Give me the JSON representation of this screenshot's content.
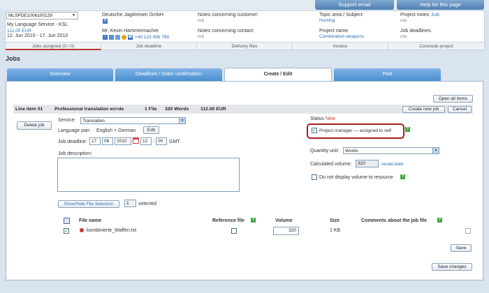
{
  "top": {
    "support": "Support email",
    "help": "Help for this page"
  },
  "header": {
    "job_select": "MLSPDE1006100129",
    "service": "My Language Service - KSL",
    "price": "112.00 EUR",
    "dates": "12. Jun 2010 - 17. Jun 2010",
    "company": "Deutsche Jagdreisen GmbH",
    "contact_name": "Mr. Kevin Hammermacher",
    "phone": "+49 123 456 789",
    "notes_customer_label": "Notes concerning customer:",
    "notes_customer_val": "n/a",
    "notes_contact_label": "Notes concerning contact:",
    "notes_contact_val": "n/a",
    "topic_label": "Topic area / Subject:",
    "topic_val": "Hunting",
    "project_name_label": "Project name",
    "project_name_val": "Combination weapons",
    "project_notes_label": "Project notes:",
    "project_notes_edit": "Edit",
    "project_notes_val": "n/a",
    "job_deadlines_label": "Job deadlines:",
    "job_deadlines_val": "n/a"
  },
  "header_tabs": [
    "Jobs assigned (0 / 0)",
    "Job deadline",
    "Delivery files",
    "Invoice",
    "Conclude project"
  ],
  "page_title": "Jobs",
  "tabs": [
    "Overview",
    "Deadlines / Order confirmation",
    "Create / Edit",
    "Post"
  ],
  "panel": {
    "open_all": "Open all items",
    "line_item": "Line item 01",
    "line_desc": "Professional translation  en>de",
    "files": "1 File",
    "words": "320 Words",
    "amount": "112.00 EUR",
    "create_new": "Create new job",
    "cancel": "Cancel",
    "delete_job": "Delete job",
    "service_label": "Service:",
    "service_val": "Translation",
    "lang_label": "Language pair:",
    "lang_val": "English > German",
    "edit": "Edit",
    "deadline_label": "Job deadline:",
    "day": "17",
    "month": "06",
    "year": "2010",
    "hour": "12",
    "minute": "00",
    "gmt": "GMT",
    "desc_label": "Job description:",
    "status_label": "Status",
    "status_val": "New",
    "pm_label": "Project manager — assigned to self",
    "qty_label": "Quantity unit:",
    "qty_val": "Words",
    "calc_label": "Calculated volume:",
    "calc_val": "320",
    "recalc": "recalculate",
    "no_display": "Do not display volume to resource",
    "show_hide": "Show/hide File Selection",
    "selected_count": "1",
    "selected_label": "selected",
    "col_file": "File name",
    "col_ref": "Reference file",
    "col_vol": "Volume",
    "col_size": "Size",
    "col_comments": "Comments about the job file",
    "file_name": "kombinierte_Waffen.txt",
    "file_vol": "320",
    "file_size": "1 KB",
    "save": "Save",
    "save_changes": "Save changes"
  },
  "colors": {
    "accent_red": "#c0392b",
    "tab_blue": "#4a8fd0",
    "link": "#2d6fb0"
  }
}
